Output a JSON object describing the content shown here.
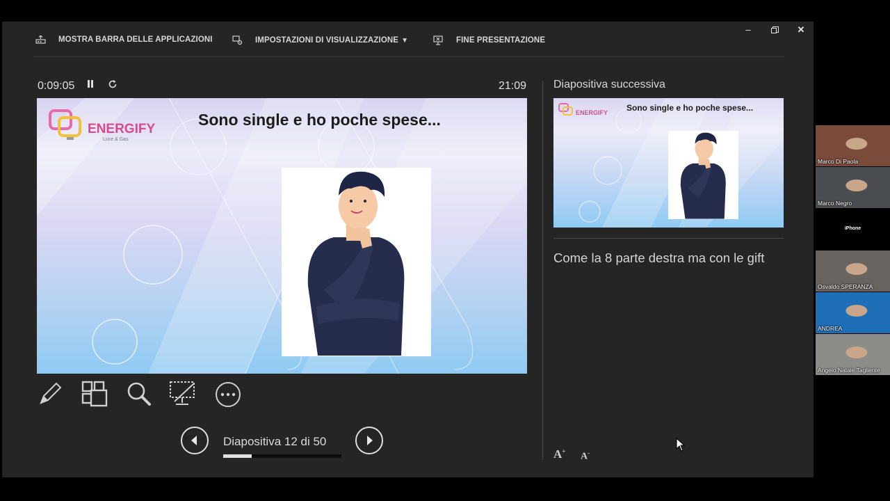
{
  "toolbar": {
    "taskbar_label": "MOSTRA BARRA DELLE APPLICAZIONI",
    "display_settings_label": "IMPOSTAZIONI DI VISUALIZZAZIONE",
    "end_presentation_label": "FINE PRESENTAZIONE"
  },
  "presenter": {
    "elapsed": "0:09:05",
    "clock": "21:09"
  },
  "current_slide": {
    "title": "Sono single e ho poche spese...",
    "logo_text": "ENERGIFY",
    "logo_sub": "Luce & Gas"
  },
  "navigation": {
    "slide_counter": "Diapositiva 12 di 50",
    "progress_fraction": 0.24
  },
  "next_slide": {
    "label": "Diapositiva successiva",
    "title": "Sono single e ho poche spese...",
    "logo_text": "ENERGIFY"
  },
  "notes": {
    "text": "Come la 8 parte destra ma con le gift"
  },
  "participants": [
    {
      "name": "Marco Di Paola",
      "bg": "#7a4a3a"
    },
    {
      "name": "Marco Negro",
      "bg": "#4a4e52"
    },
    {
      "name": "iPhone",
      "bg": "#000000"
    },
    {
      "name": "Osvaldo SPERANZA",
      "bg": "#6a6460"
    },
    {
      "name": "ANDREA",
      "bg": "#1f6fb8"
    },
    {
      "name": "Angelo Natale Tagliente",
      "bg": "#8c8c88"
    }
  ],
  "icons": {
    "window": [
      "minimize-icon",
      "restore-icon",
      "close-icon"
    ],
    "tools": [
      "pen-icon",
      "slides-grid-icon",
      "zoom-icon",
      "black-screen-icon",
      "more-icon"
    ],
    "controls": [
      "pause-icon",
      "restart-icon",
      "prev-icon",
      "next-icon",
      "font-increase-icon",
      "font-decrease-icon"
    ]
  }
}
